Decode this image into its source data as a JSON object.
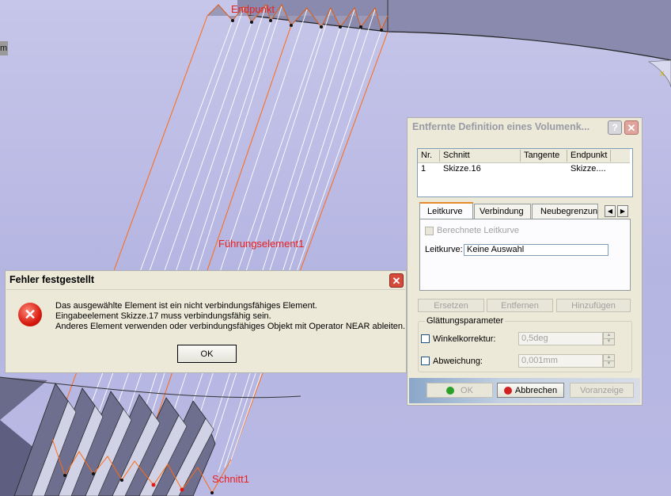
{
  "viewport": {
    "labels": {
      "endpoint": "Endpunkt",
      "guide": "Führungselement1",
      "section": "Schnitt1"
    },
    "left_tab": "m"
  },
  "error_dialog": {
    "title": "Fehler festgestellt",
    "messages": [
      "Das ausgewählte Element ist ein nicht verbindungsfähiges Element.",
      "Eingabeelement Skizze.17 muss verbindungsfähig sein.",
      "Anderes Element verwenden oder verbindungsfähiges Objekt mit Operator NEAR ableiten."
    ],
    "ok_label": "OK",
    "icon": "error-icon"
  },
  "def_dialog": {
    "title": "Entfernte Definition eines Volumenk...",
    "help_label": "?",
    "table": {
      "columns": [
        "Nr.",
        "Schnitt",
        "Tangente",
        "Endpunkt"
      ],
      "rows": [
        {
          "nr": "1",
          "schnitt": "Skizze.16",
          "tangente": "",
          "endpunkt": "Skizze...."
        }
      ]
    },
    "tabs": [
      "Leitkurve",
      "Verbindung",
      "Neubegrenzun"
    ],
    "active_tab": "Leitkurve",
    "computed_guide_label": "Berechnete Leitkurve",
    "guide_label": "Leitkurve:",
    "guide_value": "Keine Auswahl",
    "buttons": {
      "replace": "Ersetzen",
      "remove": "Entfernen",
      "add": "Hinzufügen"
    },
    "smoothing": {
      "title": "Glättungsparameter",
      "angle_label": "Winkelkorrektur:",
      "angle_value": "0,5deg",
      "deviation_label": "Abweichung:",
      "deviation_value": "0,001mm"
    },
    "footer": {
      "ok": "OK",
      "cancel": "Abbrechen",
      "preview": "Voranzeige"
    }
  }
}
